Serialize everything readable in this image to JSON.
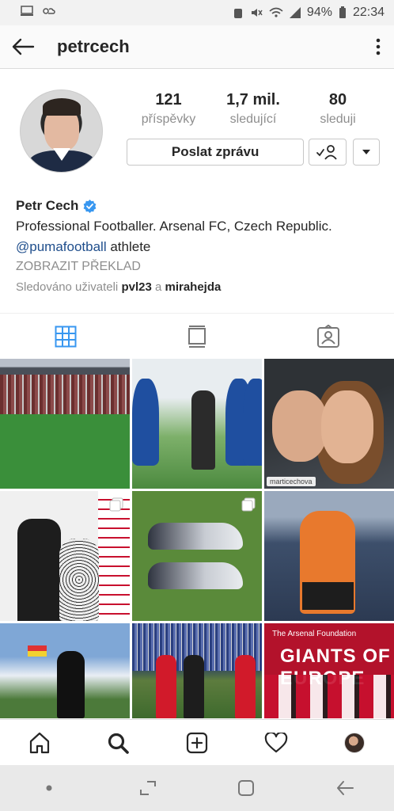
{
  "status_bar": {
    "battery_percent": "94%",
    "time": "22:34"
  },
  "header": {
    "username": "petrcech"
  },
  "profile": {
    "stats": {
      "posts_count": "121",
      "posts_label": "příspěvky",
      "followers_count": "1,7 mil.",
      "followers_label": "sledující",
      "following_count": "80",
      "following_label": "sleduji"
    },
    "message_button": "Poslat zprávu",
    "name": "Petr Cech",
    "bio_line1": "Professional Footballer. Arsenal FC, Czech Republic.",
    "bio_mention": "@pumafootball",
    "bio_mention_suffix": "athlete",
    "translate_label": "ZOBRAZIT PŘEKLAD",
    "followed_by_prefix": "Sledováno uživateli",
    "followed_by_user1": "pvl23",
    "followed_by_and": "a",
    "followed_by_user2": "mirahejda"
  },
  "grid": {
    "tag_text": "marticechova",
    "poster_header": "The Arsenal Foundation",
    "poster_title": "GIANTS OF EUROPE"
  },
  "colors": {
    "accent_blue": "#3897f0",
    "verified": "#3897f0",
    "mention": "#1f4e8c",
    "text_primary": "#262626",
    "text_secondary": "#8e8e8e"
  }
}
